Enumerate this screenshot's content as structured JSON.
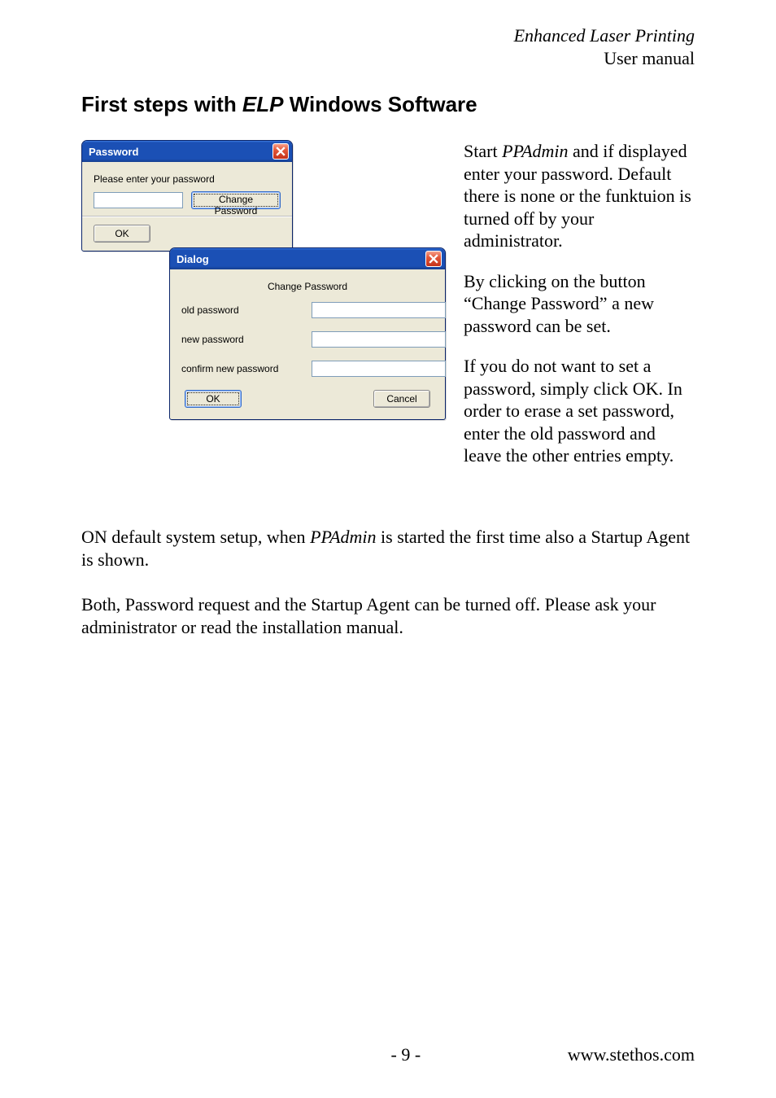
{
  "header": {
    "title_italic": "Enhanced Laser Printing",
    "subtitle": "User manual"
  },
  "section_heading": {
    "pre": "First steps with ",
    "elp": "ELP",
    "post": " Windows Software"
  },
  "right_text": {
    "p1_pre": "Start ",
    "p1_italic": "PPAdmin",
    "p1_post": " and if displayed enter your password. Default there is none or the funktuion is turned off by your administrator.",
    "p2": "By clicking on the button “Change Password” a new password can be set.",
    "p3": "If you do not want to set a password, simply click OK. In order to erase a set password, enter the old password and leave the other entries empty."
  },
  "below": {
    "p1_pre": "ON default system setup, when ",
    "p1_italic": "PPAdmin",
    "p1_post": " is started the first time also a Startup Agent is shown.",
    "p2": "Both, Password request and the Startup Agent can be turned off. Please ask your administrator or read the installation manual."
  },
  "footer": {
    "page": "- 9 -",
    "url": "www.stethos.com"
  },
  "win_password": {
    "title": "Password",
    "prompt": "Please enter your password",
    "change_btn": "Change Password",
    "ok_btn": "OK"
  },
  "win_dialog": {
    "title": "Dialog",
    "subtitle": "Change Password",
    "old_label": "old password",
    "new_label": "new password",
    "confirm_label": "confirm new password",
    "ok_btn": "OK",
    "cancel_btn": "Cancel"
  }
}
